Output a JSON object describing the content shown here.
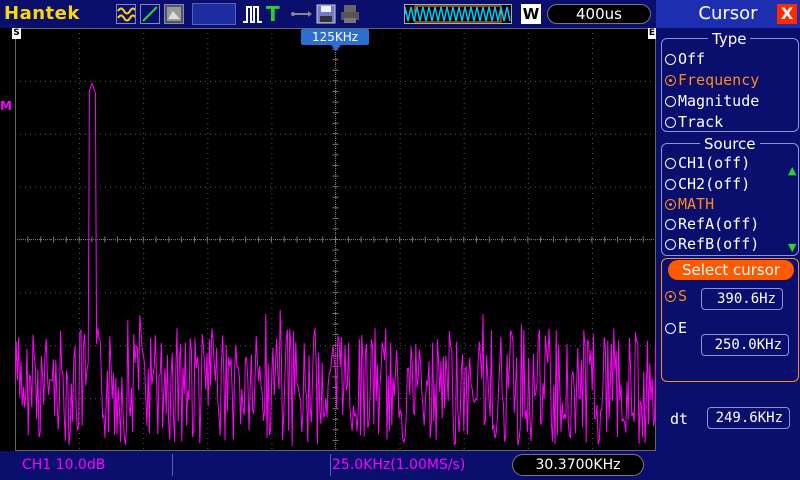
{
  "brand": "Hantek",
  "toolbar": {
    "icons": [
      "wave-icon",
      "trigger-slope-icon",
      "grayscale-icon",
      "memory-icon",
      "pulse-icon",
      "trigger-t-icon",
      "usb-icon",
      "save-icon",
      "print-icon"
    ],
    "w_label": "W",
    "timebase": "400us"
  },
  "display": {
    "trigger_freq_label": "125KHz",
    "start_marker": "S",
    "end_marker": "E",
    "math_marker": "M"
  },
  "status": {
    "ch1": "CH1 10.0dB",
    "sample_rate": "25.0KHz(1.00MS/s)",
    "frequency": "30.3700KHz"
  },
  "panel": {
    "title": "Cursor",
    "close_label": "X",
    "type_group": {
      "title": "Type",
      "options": [
        "Off",
        "Frequency",
        "Magnitude",
        "Track"
      ],
      "selected": "Frequency"
    },
    "source_group": {
      "title": "Source",
      "options": [
        "CH1(off)",
        "CH2(off)",
        "MATH",
        "RefA(off)",
        "RefB(off)"
      ],
      "selected": "MATH"
    },
    "select_cursor": {
      "title": "Select cursor",
      "s_label": "S",
      "s_value": "390.6Hz",
      "e_label": "E",
      "e_value": "250.0KHz"
    },
    "dt_label": "dt",
    "dt_value": "249.6KHz"
  },
  "colors": {
    "trace": "#ff00ff",
    "selected": "#ff8c1a",
    "panel_bg": "#0a0f6e",
    "logo": "#ffd800"
  }
}
